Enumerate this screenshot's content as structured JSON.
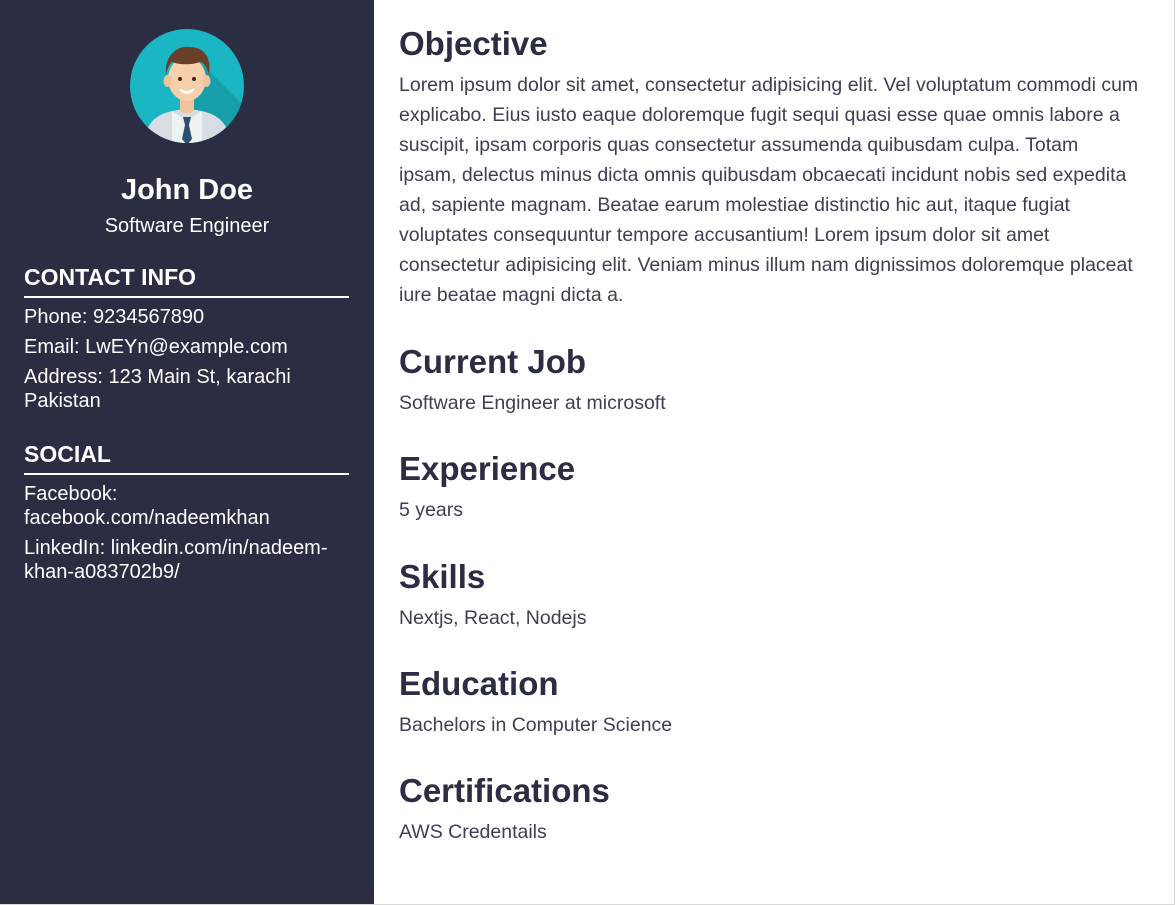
{
  "profile": {
    "name": "John Doe",
    "title": "Software Engineer"
  },
  "contact": {
    "heading": "CONTACT INFO",
    "phone": "Phone: 9234567890",
    "email": "Email: LwEYn@example.com",
    "address": "Address: 123 Main St, karachi Pakistan"
  },
  "social": {
    "heading": "SOCIAL",
    "facebook": "Facebook: facebook.com/nadeemkhan",
    "linkedin": "LinkedIn: linkedin.com/in/nadeem-khan-a083702b9/"
  },
  "sections": {
    "objective": {
      "heading": "Objective",
      "text": "Lorem ipsum dolor sit amet, consectetur adipisicing elit. Vel voluptatum commodi cum explicabo. Eius iusto eaque doloremque fugit sequi quasi esse quae omnis labore a suscipit, ipsam corporis quas consectetur assumenda quibusdam culpa. Totam ipsam, delectus minus dicta omnis quibusdam obcaecati incidunt nobis sed expedita ad, sapiente magnam. Beatae earum molestiae distinctio hic aut, itaque fugiat voluptates consequuntur tempore accusantium! Lorem ipsum dolor sit amet consectetur adipisicing elit. Veniam minus illum nam dignissimos doloremque placeat iure beatae magni dicta a."
    },
    "current_job": {
      "heading": "Current Job",
      "text": "Software Engineer at microsoft"
    },
    "experience": {
      "heading": "Experience",
      "text": "5 years"
    },
    "skills": {
      "heading": "Skills",
      "text": "Nextjs, React, Nodejs"
    },
    "education": {
      "heading": "Education",
      "text": "Bachelors in Computer Science"
    },
    "certifications": {
      "heading": "Certifications",
      "text": "AWS Credentails"
    }
  },
  "colors": {
    "sidebar_bg": "#2b2d42",
    "heading_text": "#2b2d42",
    "avatar_bg": "#1ab6c3"
  },
  "icons": {
    "avatar": "user-avatar-icon"
  }
}
